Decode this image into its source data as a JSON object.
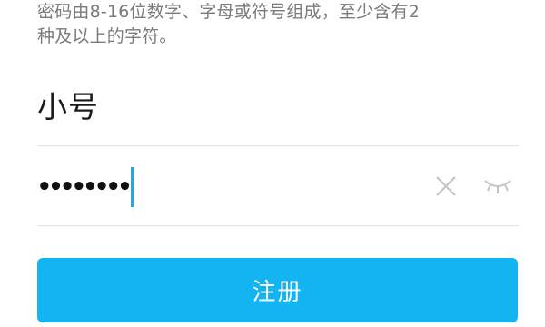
{
  "hint": {
    "line1": "密码由8-16位数字、字母或符号组成，至少含有2",
    "line2": "种及以上的字符。"
  },
  "account": {
    "nickname": "小号"
  },
  "password": {
    "masked_value": "••••••••",
    "clear_icon": "close-icon",
    "visibility_icon": "eye-closed-icon"
  },
  "register": {
    "label": "注册"
  },
  "colors": {
    "accent": "#12b5f2",
    "caret": "#1fa9e8",
    "hint_text": "#7a7a7a",
    "divider": "#e3e3e3"
  }
}
